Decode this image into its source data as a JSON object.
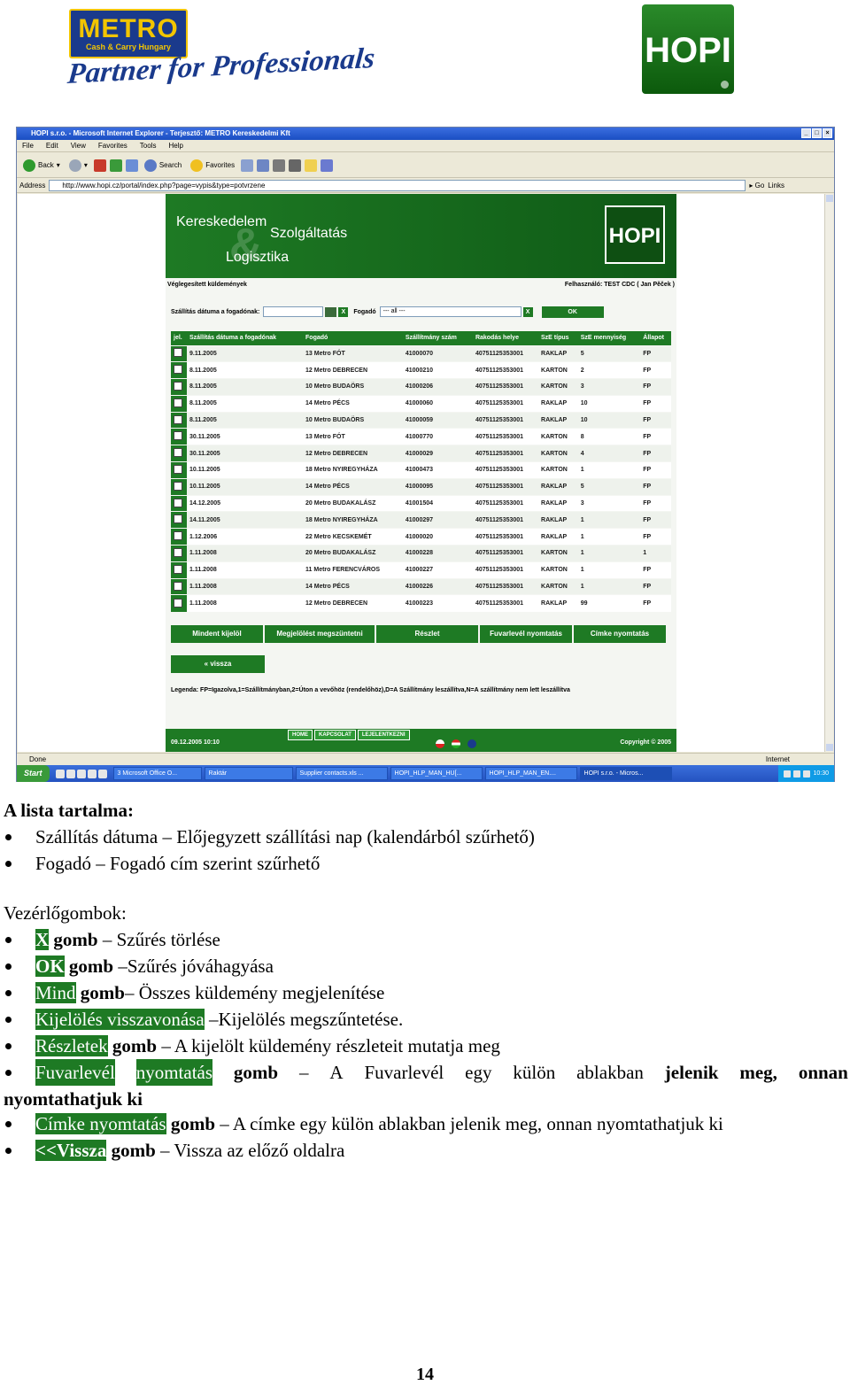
{
  "logos": {
    "metro_title": "METRO",
    "metro_sub": "Cash & Carry Hungary",
    "metro_slogan": "Partner for Professionals",
    "hopi": "HOPI"
  },
  "browser": {
    "title": "HOPI s.r.o. - Microsoft Internet Explorer - Terjesztő: METRO Kereskedelmi Kft",
    "menu": [
      "File",
      "Edit",
      "View",
      "Favorites",
      "Tools",
      "Help"
    ],
    "toolbar": {
      "back": "Back",
      "search": "Search",
      "favorites": "Favorites"
    },
    "address_label": "Address",
    "address": "http://www.hopi.cz/portal/index.php?page=vypis&type=potvrzene",
    "go": "Go",
    "links": "Links",
    "status": "Done",
    "zone": "Internet"
  },
  "site": {
    "banner": {
      "w1": "Kereskedelem",
      "w2": "Szolgáltatás",
      "w3": "Logisztika",
      "logo": "HOPI"
    },
    "section_title": "Véglegesített küldemények",
    "user": "Felhasználó: TEST CDC ( Jan Pěček )",
    "filter": {
      "date_label": "Szállítás dátuma a fogadónak:",
      "x": "X",
      "recipient_label": "Fogadó",
      "recipient_value": "--- all ---",
      "x2": "X",
      "ok": "OK"
    },
    "columns": [
      "jel.",
      "Szállítás dátuma a fogadónak",
      "Fogadó",
      "Szállítmány szám",
      "Rakodás helye",
      "SzE típus",
      "SzE mennyiség",
      "Állapot"
    ],
    "rows": [
      [
        "9.11.2005",
        "13 Metro FÓT",
        "41000070",
        "40751125353001",
        "RAKLAP",
        "5",
        "FP"
      ],
      [
        "8.11.2005",
        "12 Metro DEBRECEN",
        "41000210",
        "40751125353001",
        "KARTON",
        "2",
        "FP"
      ],
      [
        "8.11.2005",
        "10 Metro BUDAÖRS",
        "41000206",
        "40751125353001",
        "KARTON",
        "3",
        "FP"
      ],
      [
        "8.11.2005",
        "14 Metro PÉCS",
        "41000060",
        "40751125353001",
        "RAKLAP",
        "10",
        "FP"
      ],
      [
        "8.11.2005",
        "10 Metro BUDAÖRS",
        "41000059",
        "40751125353001",
        "RAKLAP",
        "10",
        "FP"
      ],
      [
        "30.11.2005",
        "13 Metro FÓT",
        "41000770",
        "40751125353001",
        "KARTON",
        "8",
        "FP"
      ],
      [
        "30.11.2005",
        "12 Metro DEBRECEN",
        "41000029",
        "40751125353001",
        "KARTON",
        "4",
        "FP"
      ],
      [
        "10.11.2005",
        "18 Metro NYIREGYHÁZA",
        "41000473",
        "40751125353001",
        "KARTON",
        "1",
        "FP"
      ],
      [
        "10.11.2005",
        "14 Metro PÉCS",
        "41000095",
        "40751125353001",
        "RAKLAP",
        "5",
        "FP"
      ],
      [
        "14.12.2005",
        "20 Metro BUDAKALÁSZ",
        "41001504",
        "40751125353001",
        "RAKLAP",
        "3",
        "FP"
      ],
      [
        "14.11.2005",
        "18 Metro NYIREGYHÁZA",
        "41000297",
        "40751125353001",
        "RAKLAP",
        "1",
        "FP"
      ],
      [
        "1.12.2006",
        "22 Metro KECSKEMÉT",
        "41000020",
        "40751125353001",
        "RAKLAP",
        "1",
        "FP"
      ],
      [
        "1.11.2008",
        "20 Metro BUDAKALÁSZ",
        "41000228",
        "40751125353001",
        "KARTON",
        "1",
        "1"
      ],
      [
        "1.11.2008",
        "11 Metro FERENCVÁROS",
        "41000227",
        "40751125353001",
        "KARTON",
        "1",
        "FP"
      ],
      [
        "1.11.2008",
        "14 Metro PÉCS",
        "41000226",
        "40751125353001",
        "KARTON",
        "1",
        "FP"
      ],
      [
        "1.11.2008",
        "12 Metro DEBRECEN",
        "41000223",
        "40751125353001",
        "RAKLAP",
        "99",
        "FP"
      ]
    ],
    "buttons": {
      "select_all": "Mindent kijelöl",
      "deselect": "Megjelölést megszüntetni",
      "details": "Részlet",
      "print_waybill": "Fuvarlevél nyomtatás",
      "print_label": "Címke nyomtatás",
      "back": "« vissza"
    },
    "legend": "Legenda: FP=Igazolva,1=Szállítmányban,2=Úton a vevőhöz (rendelőhöz),D=A Szállítmány leszállítva,N=A szállítmány nem lett leszállítva",
    "footer": {
      "date": "09.12.2005 10:10",
      "nav": [
        "HOME",
        "KAPCSOLAT",
        "LEJELENTKEZNI"
      ],
      "copyright": "Copyright © 2005"
    }
  },
  "taskbar": {
    "start": "Start",
    "tasks": [
      "3 Microsoft Office O...",
      "Raktár",
      "Supplier contacts.xls ...",
      "HOPI_HLP_MAN_HU[...",
      "HOPI_HLP_MAN_EN....",
      "HOPI s.r.o. - Micros..."
    ],
    "clock": "10:30"
  },
  "doc": {
    "list_title": "A lista tartalma:",
    "items": [
      "Szállítás dátuma – Előjegyzett szállítási nap (kalendárból szűrhető)",
      "Fogadó – Fogadó cím szerint szűrhető"
    ],
    "controls_title": "Vezérlőgombok:",
    "c1": {
      "hl": "X",
      "b": " gomb",
      "t": " – Szűrés törlése"
    },
    "c2": {
      "hl": "OK",
      "b": " gomb",
      "t": " –Szűrés jóváhagyása"
    },
    "c3": {
      "hl": "Mind",
      "b": " gomb",
      "t": "– Összes küldemény megjelenítése"
    },
    "c4": {
      "hl": "Kijelölés visszavonása",
      "t": " –Kijelölés megszűntetése."
    },
    "c5": {
      "hl": "Részletek",
      "b": " gomb",
      "t": " – A kijelölt küldemény részleteit mutatja meg"
    },
    "c6": {
      "hl1": "Fuvarlevél",
      "hl2": "nyomtatás",
      "words": [
        "gomb",
        "–",
        "A",
        "Fuvarlevél",
        "egy",
        "külön",
        "ablakban",
        "jelenik",
        "meg,",
        "onnan"
      ],
      "line2": "nyomtathatjuk ki"
    },
    "c7": {
      "hl": "Címke nyomtatás",
      "b": " gomb",
      "t": " – A címke egy külön ablakban jelenik meg, onnan nyomtathatjuk ki"
    },
    "c8": {
      "hl": "<<Vissza",
      "b": " gomb",
      "t": " – Vissza az előző oldalra"
    },
    "page_number": "14"
  },
  "colors": {
    "accent_green": "#1e7a24",
    "metro_blue": "#1a3a8c",
    "metro_yellow": "#f2c500"
  }
}
